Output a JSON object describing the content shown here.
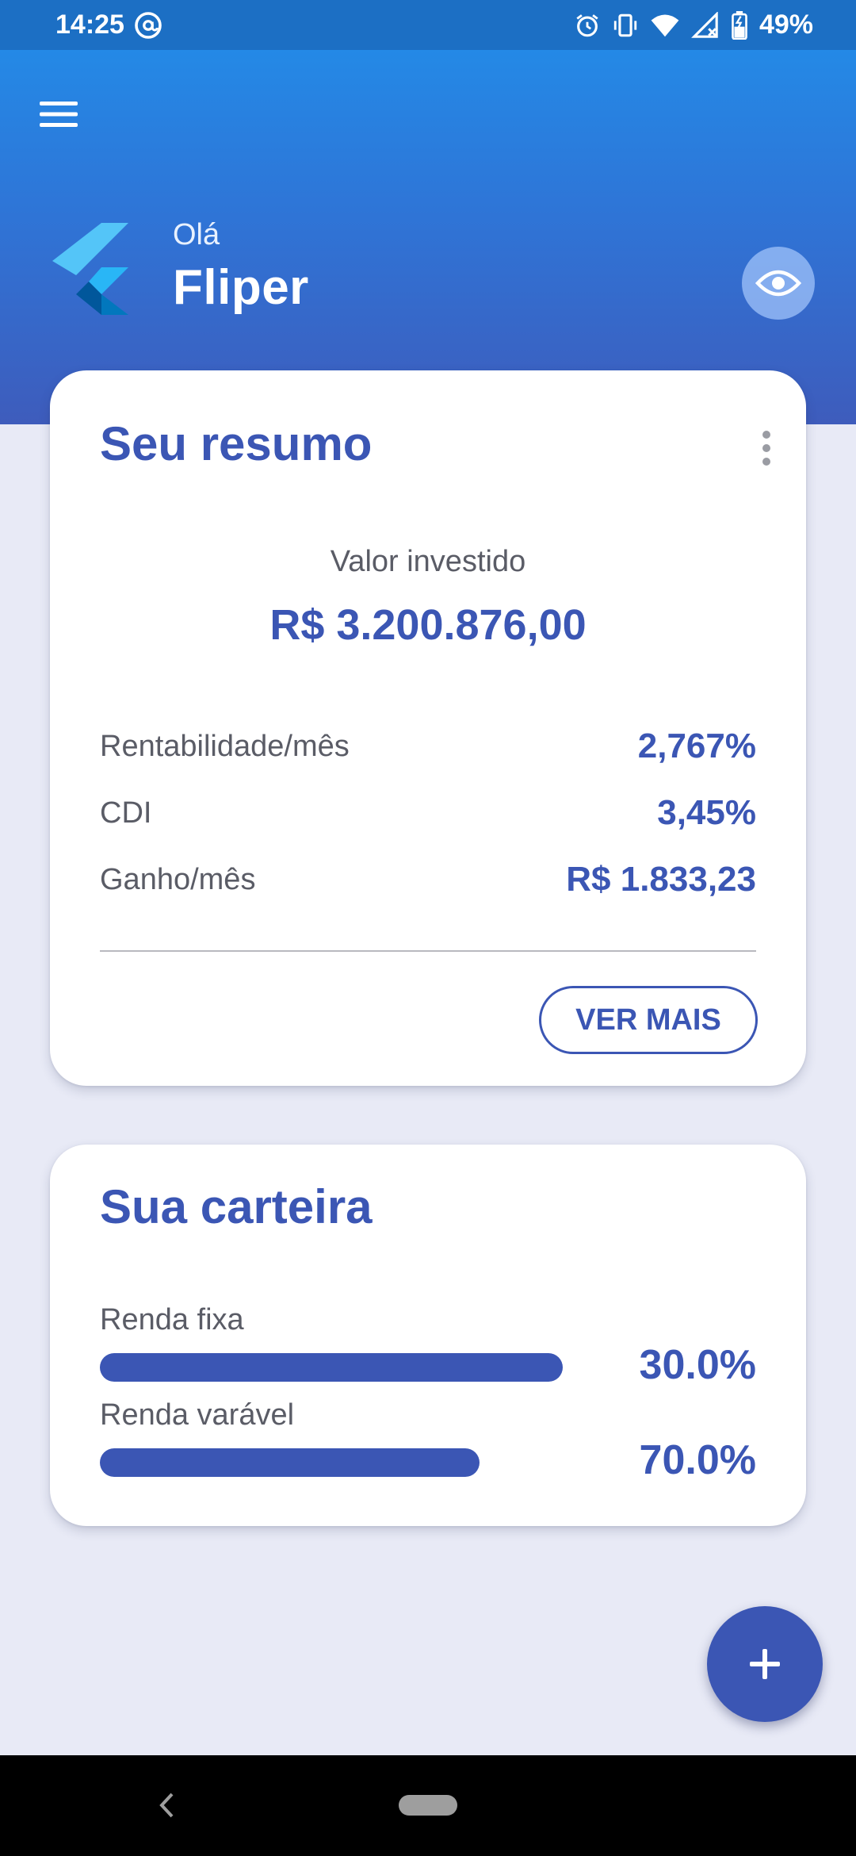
{
  "status_bar": {
    "time": "14:25",
    "battery": "49%",
    "icons": [
      "at-sign-icon",
      "alarm-icon",
      "vibrate-icon",
      "wifi-icon",
      "no-signal-icon",
      "battery-icon"
    ]
  },
  "header": {
    "menu_icon": "hamburger-menu-icon",
    "logo": "flutter-logo",
    "greeting": "Olá",
    "username": "Fliper",
    "visibility_icon": "eye-icon"
  },
  "summary": {
    "title": "Seu resumo",
    "more_icon": "more-vert-icon",
    "invested_label": "Valor investido",
    "invested_value": "R$ 3.200.876,00",
    "stats": [
      {
        "label": "Rentabilidade/mês",
        "value": "2,767%"
      },
      {
        "label": "CDI",
        "value": "3,45%"
      },
      {
        "label": "Ganho/mês",
        "value": "R$ 1.833,23"
      }
    ],
    "button_label": "VER MAIS"
  },
  "wallet": {
    "title": "Sua carteira",
    "allocations": [
      {
        "label": "Renda fixa",
        "percent_label": "30.0%",
        "bar_fill": 1.0
      },
      {
        "label": "Renda varável",
        "percent_label": "70.0%",
        "bar_fill": 0.82
      }
    ]
  },
  "fab": {
    "icon": "plus-icon"
  },
  "nav_bar": {
    "back_icon": "back-chevron-icon",
    "home_icon": "home-pill-icon"
  },
  "colors": {
    "primary": "#3b56b4",
    "header_gradient_top": "#2489e6",
    "header_gradient_bottom": "#3e5cbc",
    "background": "#e8eaf6",
    "status_bar": "#1c6fc4"
  }
}
